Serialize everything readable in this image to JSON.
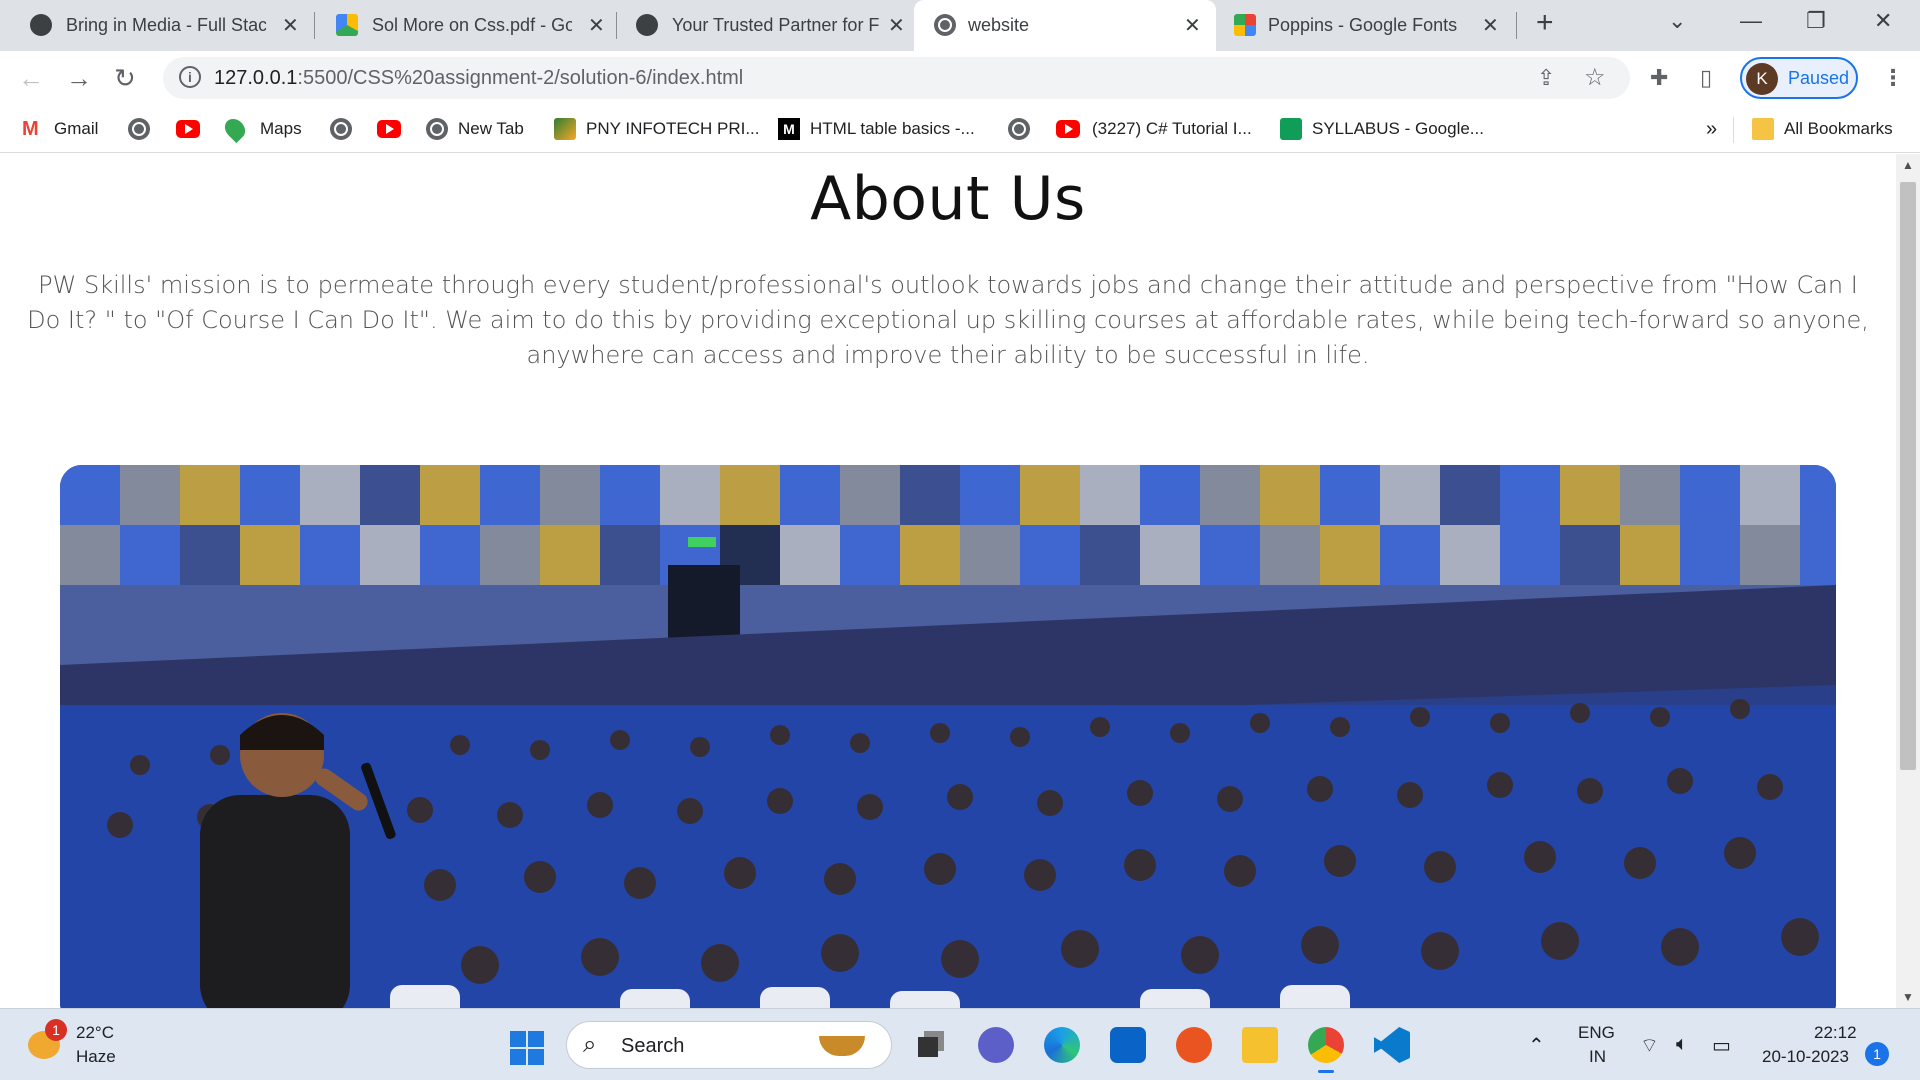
{
  "browser": {
    "tabs": [
      {
        "title": "Bring in Media - Full Stac",
        "icon": "wordpress-icon",
        "active": false
      },
      {
        "title": "Sol More on Css.pdf - Go",
        "icon": "google-drive-icon",
        "active": false
      },
      {
        "title": "Your Trusted Partner for F",
        "icon": "wordpress-icon",
        "active": false
      },
      {
        "title": "website",
        "icon": "globe-icon",
        "active": true
      },
      {
        "title": "Poppins - Google Fonts",
        "icon": "google-fonts-icon",
        "active": false
      }
    ],
    "new_tab_label": "+",
    "url_host": "127.0.0.1",
    "url_path": ":5500/CSS%20assignment-2/solution-6/index.html",
    "profile_initial": "K",
    "profile_label": "Paused",
    "bookmarks": [
      {
        "label": "Gmail",
        "icon": "gmail-icon"
      },
      {
        "label": "",
        "icon": "globe-icon"
      },
      {
        "label": "",
        "icon": "youtube-icon"
      },
      {
        "label": "Maps",
        "icon": "maps-icon"
      },
      {
        "label": "",
        "icon": "globe-icon"
      },
      {
        "label": "",
        "icon": "youtube-icon"
      },
      {
        "label": "New Tab",
        "icon": "globe-icon"
      },
      {
        "label": "PNY INFOTECH PRI...",
        "icon": "pny-icon"
      },
      {
        "label": "HTML table basics -...",
        "icon": "mdn-icon"
      },
      {
        "label": "",
        "icon": "globe-icon"
      },
      {
        "label": "(3227) C# Tutorial I...",
        "icon": "youtube-icon"
      },
      {
        "label": "SYLLABUS - Google...",
        "icon": "google-sheets-icon"
      }
    ],
    "bookmarks_overflow": "»",
    "all_bookmarks": "All Bookmarks"
  },
  "page": {
    "heading": "About Us",
    "mission": "PW Skills' mission is to permeate through every student/professional's outlook towards jobs and change their attitude and perspective from \"How Can I Do It? \" to \"Of Course I Can Do It\". We aim to do this by providing exceptional up skilling courses at affordable rates, while being tech-forward so anyone, anywhere can access and improve their ability to be successful in life."
  },
  "taskbar": {
    "weather_badge": "1",
    "temperature": "22°C",
    "condition": "Haze",
    "search_label": "Search",
    "lang_top": "ENG",
    "lang_bottom": "IN",
    "time": "22:12",
    "date": "20-10-2023",
    "notifications": "1"
  },
  "colors": {
    "accent": "#1a73e8",
    "tabstrip": "#dee1e6",
    "taskbar": "#dde6f1",
    "hero_seats": "#2a3f8a"
  }
}
